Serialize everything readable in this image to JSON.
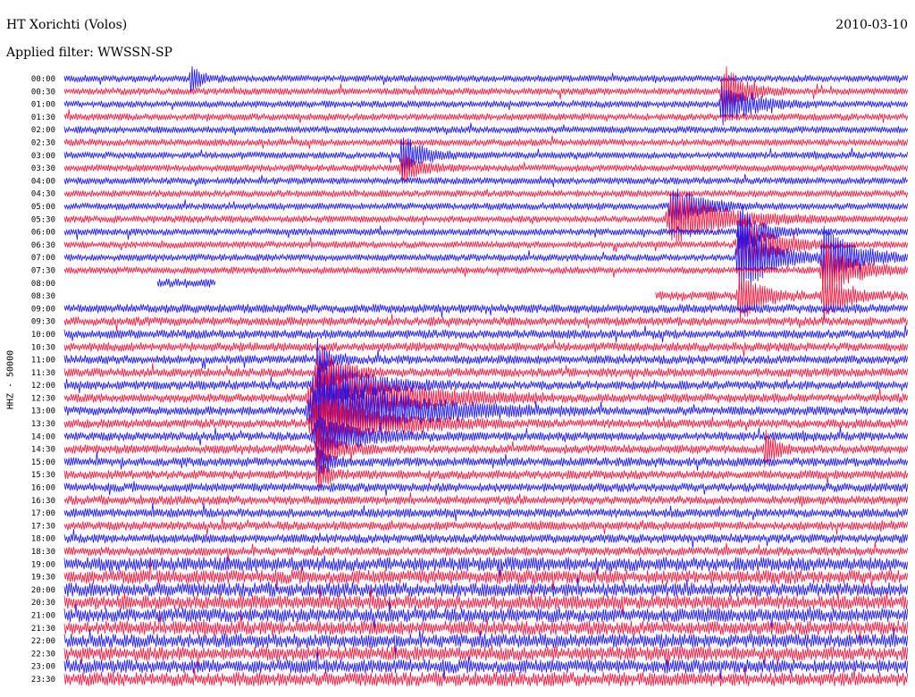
{
  "header": {
    "station_title": "HT Xorichti (Volos)",
    "date": "2010-03-10",
    "filter_text": "Applied filter: WWSSN-SP",
    "channel_label": "HHZ - 50000"
  },
  "colors": {
    "series_a": "#1a14f0",
    "series_b": "#f0143c",
    "background": "#ffffff",
    "text": "#000000"
  },
  "chart_data": {
    "type": "line",
    "title": "HT Xorichti (Volos)",
    "subtitle": "Applied filter: WWSSN-SP",
    "ylabel": "HHZ - 50000",
    "xlabel": "",
    "grid": false,
    "y_tick_labels": [
      "00:00",
      "00:30",
      "01:00",
      "01:30",
      "02:00",
      "02:30",
      "03:00",
      "03:30",
      "04:00",
      "04:30",
      "05:00",
      "05:30",
      "06:00",
      "06:30",
      "07:00",
      "07:30",
      "08:00",
      "08:30",
      "09:00",
      "09:30",
      "10:00",
      "10:30",
      "11:00",
      "11:30",
      "12:00",
      "12:30",
      "13:00",
      "13:30",
      "14:00",
      "14:30",
      "15:00",
      "15:30",
      "16:00",
      "16:30",
      "17:00",
      "17:30",
      "18:00",
      "18:30",
      "19:00",
      "19:30",
      "20:00",
      "20:30",
      "21:00",
      "21:30",
      "22:00",
      "22:30",
      "23:00",
      "23:30"
    ],
    "trace_colors": [
      "#1a14f0",
      "#f0143c"
    ],
    "traces_minutes_per_line": 30,
    "gaps": [
      {
        "trace": "08:00",
        "from_fraction": 0.18,
        "to_fraction": 1.0
      },
      {
        "trace": "08:00",
        "from_fraction": 0.0,
        "to_fraction": 0.11
      },
      {
        "trace": "08:30",
        "from_fraction": 0.0,
        "to_fraction": 0.7
      }
    ],
    "events": [
      {
        "trace": "00:00",
        "position_fraction": 0.15,
        "amplitude": 2.0,
        "duration_fraction": 0.01
      },
      {
        "trace": "00:30",
        "position_fraction": 0.78,
        "amplitude": 4.0,
        "duration_fraction": 0.02
      },
      {
        "trace": "01:00",
        "position_fraction": 0.78,
        "amplitude": 3.0,
        "duration_fraction": 0.03
      },
      {
        "trace": "03:00",
        "position_fraction": 0.4,
        "amplitude": 3.0,
        "duration_fraction": 0.02
      },
      {
        "trace": "03:30",
        "position_fraction": 0.4,
        "amplitude": 2.0,
        "duration_fraction": 0.02
      },
      {
        "trace": "05:00",
        "position_fraction": 0.72,
        "amplitude": 3.0,
        "duration_fraction": 0.03
      },
      {
        "trace": "05:30",
        "position_fraction": 0.72,
        "amplitude": 4.0,
        "duration_fraction": 0.05
      },
      {
        "trace": "06:00",
        "position_fraction": 0.8,
        "amplitude": 4.0,
        "duration_fraction": 0.02
      },
      {
        "trace": "06:30",
        "position_fraction": 0.8,
        "amplitude": 5.0,
        "duration_fraction": 0.03
      },
      {
        "trace": "07:00",
        "position_fraction": 0.8,
        "amplitude": 6.0,
        "duration_fraction": 0.03
      },
      {
        "trace": "07:00",
        "position_fraction": 0.9,
        "amplitude": 5.0,
        "duration_fraction": 0.03
      },
      {
        "trace": "07:30",
        "position_fraction": 0.9,
        "amplitude": 4.0,
        "duration_fraction": 0.03
      },
      {
        "trace": "08:30",
        "position_fraction": 0.8,
        "amplitude": 4.0,
        "duration_fraction": 0.02
      },
      {
        "trace": "08:30",
        "position_fraction": 0.9,
        "amplitude": 4.0,
        "duration_fraction": 0.02
      },
      {
        "trace": "11:00",
        "position_fraction": 0.3,
        "amplitude": 3.0,
        "duration_fraction": 0.01
      },
      {
        "trace": "11:30",
        "position_fraction": 0.3,
        "amplitude": 4.0,
        "duration_fraction": 0.02
      },
      {
        "trace": "12:00",
        "position_fraction": 0.3,
        "amplitude": 5.0,
        "duration_fraction": 0.04
      },
      {
        "trace": "12:30",
        "position_fraction": 0.3,
        "amplitude": 6.0,
        "duration_fraction": 0.07
      },
      {
        "trace": "13:00",
        "position_fraction": 0.3,
        "amplitude": 6.0,
        "duration_fraction": 0.08
      },
      {
        "trace": "13:30",
        "position_fraction": 0.3,
        "amplitude": 4.0,
        "duration_fraction": 0.06
      },
      {
        "trace": "14:00",
        "position_fraction": 0.3,
        "amplitude": 3.0,
        "duration_fraction": 0.04
      },
      {
        "trace": "14:30",
        "position_fraction": 0.3,
        "amplitude": 3.0,
        "duration_fraction": 0.02
      },
      {
        "trace": "14:30",
        "position_fraction": 0.83,
        "amplitude": 3.0,
        "duration_fraction": 0.01
      },
      {
        "trace": "15:00",
        "position_fraction": 0.3,
        "amplitude": 3.0,
        "duration_fraction": 0.01
      },
      {
        "trace": "15:30",
        "position_fraction": 0.3,
        "amplitude": 2.5,
        "duration_fraction": 0.01
      }
    ],
    "noise_levels": [
      {
        "from": "00:00",
        "to": "07:30",
        "level": 0.7
      },
      {
        "from": "09:00",
        "to": "18:30",
        "level": 0.9
      },
      {
        "from": "19:00",
        "to": "23:30",
        "level": 1.4
      }
    ]
  }
}
